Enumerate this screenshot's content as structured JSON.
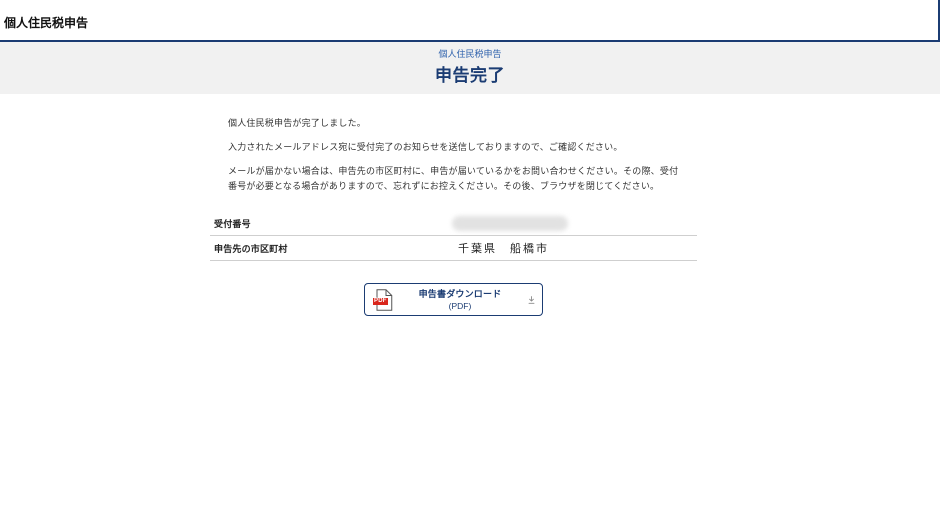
{
  "header": {
    "title": "個人住民税申告"
  },
  "banner": {
    "subtitle": "個人住民税申告",
    "title": "申告完了"
  },
  "messages": [
    "個人住民税申告が完了しました。",
    "入力されたメールアドレス宛に受付完了のお知らせを送信しておりますので、ご確認ください。",
    "メールが届かない場合は、申告先の市区町村に、申告が届いているかをお問い合わせください。その際、受付番号が必要となる場合がありますので、忘れずにお控えください。その後、ブラウザを閉じてください。"
  ],
  "summary": {
    "rows": [
      {
        "label": "受付番号"
      },
      {
        "label": "申告先の市区町村",
        "value": "千葉県　船橋市"
      }
    ]
  },
  "download": {
    "label": "申告書ダウンロード",
    "format": "(PDF)",
    "icon_badge": "PDF",
    "file_icon": "pdf-file-icon",
    "action_icon": "download-icon"
  },
  "colors": {
    "navy": "#1b3c73",
    "accent": "#2f62ad",
    "text": "#333333",
    "band": "#f1f1f1",
    "rule": "#cfcfcf",
    "pdf": "#d9261c",
    "muted": "#8a8a8a"
  }
}
